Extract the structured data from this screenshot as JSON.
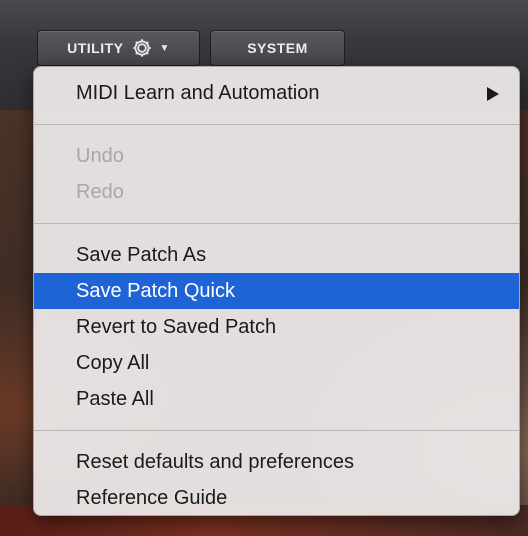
{
  "toolbar": {
    "utility_label": "UTILITY",
    "system_label": "SYSTEM"
  },
  "menu": {
    "groups": [
      [
        {
          "label": "MIDI Learn and Automation",
          "enabled": true,
          "submenu": true
        }
      ],
      [
        {
          "label": "Undo",
          "enabled": false
        },
        {
          "label": "Redo",
          "enabled": false
        }
      ],
      [
        {
          "label": "Save Patch As",
          "enabled": true
        },
        {
          "label": "Save Patch Quick",
          "enabled": true,
          "highlighted": true
        },
        {
          "label": "Revert to Saved Patch",
          "enabled": true
        },
        {
          "label": "Copy All",
          "enabled": true
        },
        {
          "label": "Paste All",
          "enabled": true
        }
      ],
      [
        {
          "label": "Reset defaults and preferences",
          "enabled": true
        },
        {
          "label": "Reference Guide",
          "enabled": true
        }
      ]
    ]
  },
  "colors": {
    "highlight": "#1f64d6",
    "disabled_text": "#a8a6a6"
  },
  "icons": {
    "utility": "gear-icon",
    "utility_caret": "chevron-down-icon",
    "submenu": "chevron-right-icon"
  }
}
